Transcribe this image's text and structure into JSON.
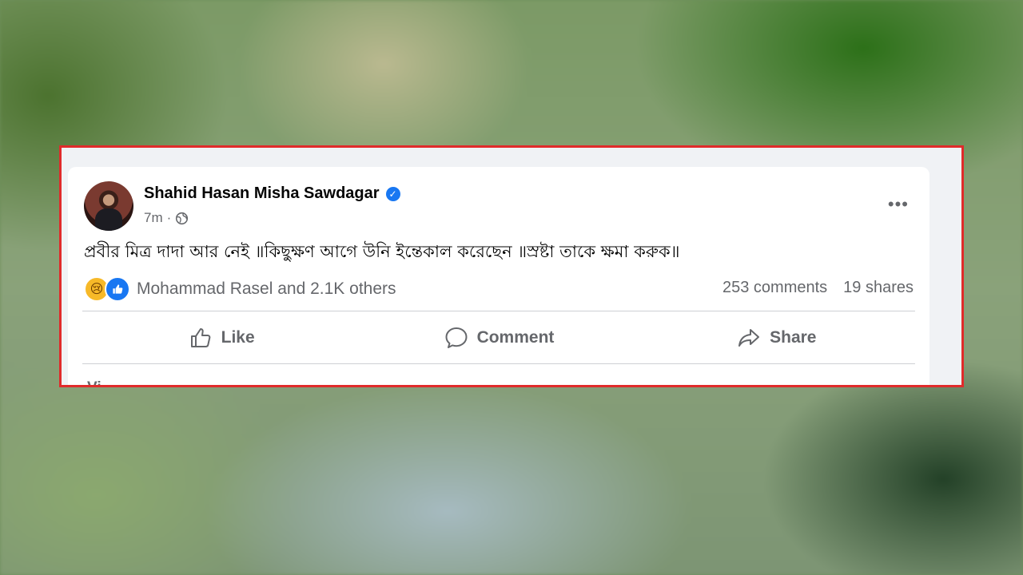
{
  "post": {
    "author": "Shahid Hasan Misha Sawdagar",
    "verified_icon": "verified-badge-icon",
    "time": "7m",
    "separator": "·",
    "privacy_icon": "globe-icon",
    "text": "প্রবীর মিত্র দাদা আর নেই ॥কিছুক্ষণ আগে উনি ইন্তেকাল করেছেন ॥স্রষ্টা তাকে ক্ষমা করুক॥",
    "more_icon": "•••",
    "reactions_text": "Mohammad Rasel and 2.1K others",
    "comments": "253 comments",
    "shares": "19 shares",
    "view_more_partial": "Vi"
  },
  "actions": {
    "like": "Like",
    "comment": "Comment",
    "share": "Share"
  },
  "colors": {
    "highlight_border": "#e02b2b",
    "facebook_blue": "#1877f2",
    "sad_reaction": "#f7b928"
  }
}
